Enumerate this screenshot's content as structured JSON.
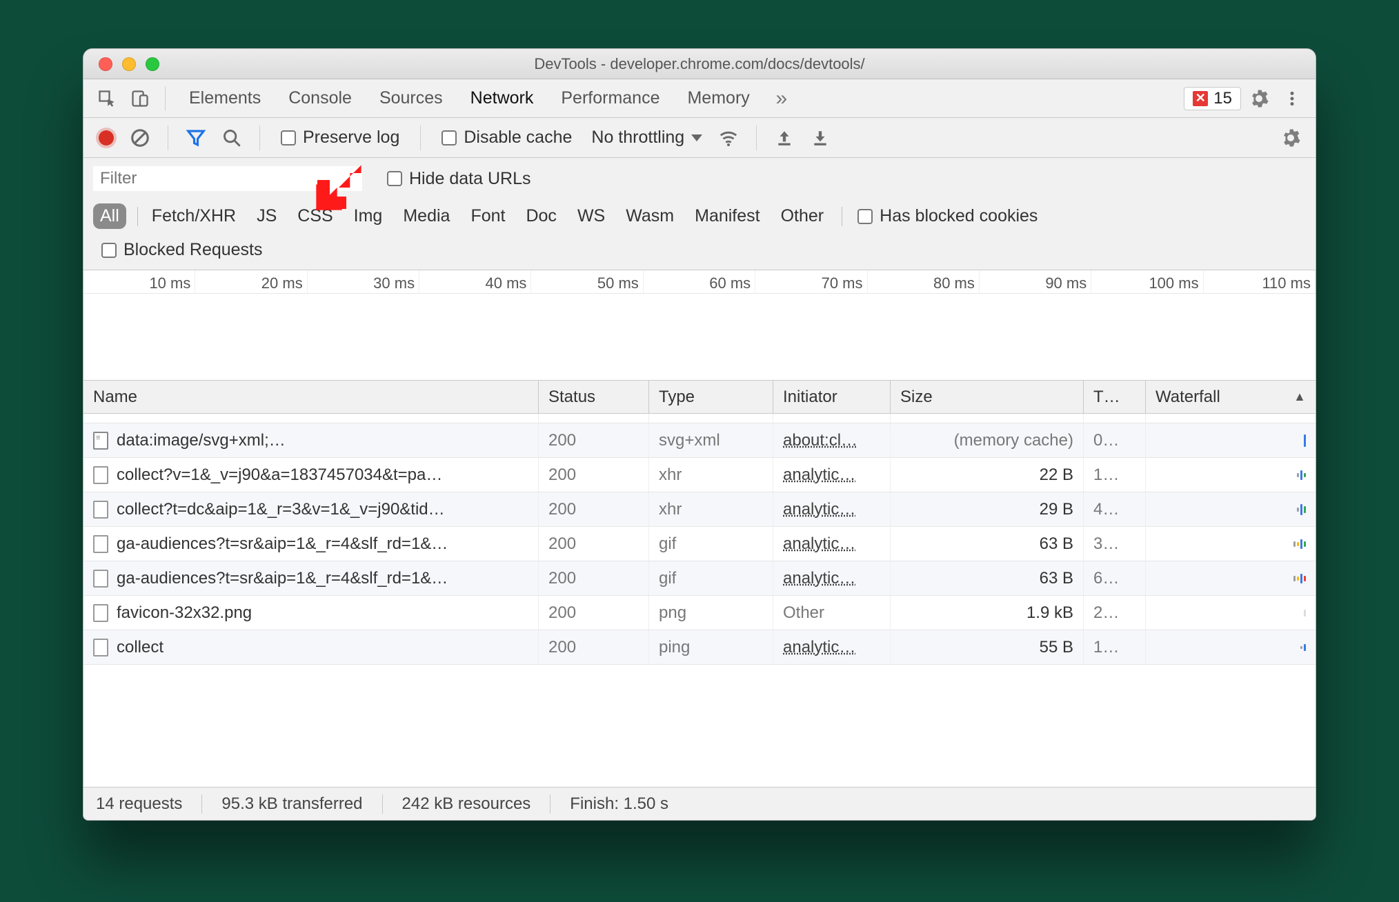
{
  "window": {
    "title": "DevTools - developer.chrome.com/docs/devtools/"
  },
  "tabbar": {
    "tabs": [
      "Elements",
      "Console",
      "Sources",
      "Network",
      "Performance",
      "Memory"
    ],
    "active": "Network",
    "error_count": "15"
  },
  "toolbar": {
    "preserve_log": "Preserve log",
    "disable_cache": "Disable cache",
    "throttling": "No throttling"
  },
  "filter": {
    "placeholder": "Filter",
    "hide_data_urls": "Hide data URLs",
    "types": [
      "All",
      "Fetch/XHR",
      "JS",
      "CSS",
      "Img",
      "Media",
      "Font",
      "Doc",
      "WS",
      "Wasm",
      "Manifest",
      "Other"
    ],
    "active_type": "All",
    "has_blocked_cookies": "Has blocked cookies",
    "blocked_requests": "Blocked Requests"
  },
  "timeline": {
    "ticks": [
      "10 ms",
      "20 ms",
      "30 ms",
      "40 ms",
      "50 ms",
      "60 ms",
      "70 ms",
      "80 ms",
      "90 ms",
      "100 ms",
      "110 ms"
    ]
  },
  "grid": {
    "columns": [
      "Name",
      "Status",
      "Type",
      "Initiator",
      "Size",
      "T…",
      "Waterfall"
    ],
    "sort_col": "Waterfall",
    "rows": [
      {
        "name": "data:image/svg+xml;…",
        "icon": "doc",
        "status": "200",
        "type": "svg+xml",
        "initiator": "about:cl…",
        "initiator_link": true,
        "size": "(memory cache)",
        "size_muted": true,
        "time": "0…",
        "wf": [
          [
            "#3b78e7",
            18
          ]
        ]
      },
      {
        "name": "collect?v=1&_v=j90&a=1837457034&t=pa…",
        "icon": "file",
        "status": "200",
        "type": "xhr",
        "initiator": "analytic…",
        "initiator_link": true,
        "size": "22 B",
        "time": "1…",
        "wf": [
          [
            "#9aa0a6",
            6
          ],
          [
            "#3b78e7",
            14
          ],
          [
            "#34a853",
            6
          ]
        ]
      },
      {
        "name": "collect?t=dc&aip=1&_r=3&v=1&_v=j90&tid…",
        "icon": "file",
        "status": "200",
        "type": "xhr",
        "initiator": "analytic…",
        "initiator_link": true,
        "size": "29 B",
        "time": "4…",
        "wf": [
          [
            "#9aa0a6",
            6
          ],
          [
            "#3b78e7",
            16
          ],
          [
            "#34a853",
            10
          ]
        ]
      },
      {
        "name": "ga-audiences?t=sr&aip=1&_r=4&slf_rd=1&…",
        "icon": "file",
        "status": "200",
        "type": "gif",
        "initiator": "analytic…",
        "initiator_link": true,
        "size": "63 B",
        "time": "3…",
        "wf": [
          [
            "#9aa0a6",
            8
          ],
          [
            "#fbbc04",
            6
          ],
          [
            "#3b78e7",
            14
          ],
          [
            "#34a853",
            8
          ]
        ]
      },
      {
        "name": "ga-audiences?t=sr&aip=1&_r=4&slf_rd=1&…",
        "icon": "file",
        "status": "200",
        "type": "gif",
        "initiator": "analytic…",
        "initiator_link": true,
        "size": "63 B",
        "time": "6…",
        "wf": [
          [
            "#9aa0a6",
            8
          ],
          [
            "#fbbc04",
            6
          ],
          [
            "#3b78e7",
            14
          ],
          [
            "#ea4335",
            8
          ]
        ]
      },
      {
        "name": "favicon-32x32.png",
        "icon": "file",
        "status": "200",
        "type": "png",
        "initiator": "Other",
        "initiator_link": false,
        "size": "1.9 kB",
        "time": "2…",
        "wf": [
          [
            "#dadce0",
            10
          ]
        ]
      },
      {
        "name": "collect",
        "icon": "file",
        "status": "200",
        "type": "ping",
        "initiator": "analytic…",
        "initiator_link": true,
        "size": "55 B",
        "time": "1…",
        "wf": [
          [
            "#9aa0a6",
            4
          ],
          [
            "#3b78e7",
            10
          ]
        ]
      }
    ]
  },
  "status": {
    "items": [
      "14 requests",
      "95.3 kB transferred",
      "242 kB resources",
      "Finish: 1.50 s"
    ]
  }
}
